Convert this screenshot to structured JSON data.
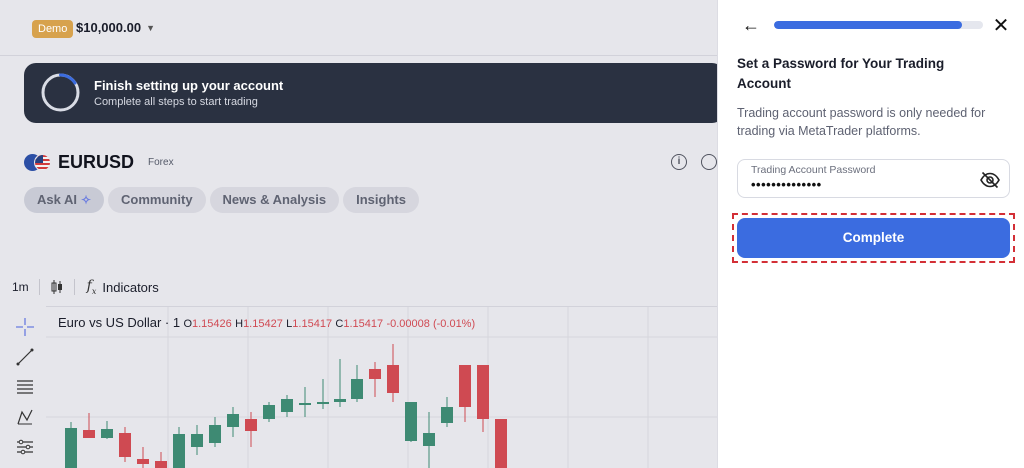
{
  "header": {
    "demo_badge": "Demo",
    "balance": "$10,000.00"
  },
  "setup_banner": {
    "title": "Finish setting up your account",
    "subtitle": "Complete all steps to start trading"
  },
  "instrument": {
    "symbol": "EURUSD",
    "type": "Forex"
  },
  "tabs": [
    {
      "label": "Ask AI"
    },
    {
      "label": "Community"
    },
    {
      "label": "News & Analysis"
    },
    {
      "label": "Insights"
    }
  ],
  "chart_toolbar": {
    "timeframe": "1m",
    "indicators_label": "Indicators"
  },
  "chart_legend": {
    "name": "Euro vs US Dollar · 1",
    "o_key": "O",
    "o_val": "1.15426",
    "h_key": "H",
    "h_val": "1.15427",
    "l_key": "L",
    "l_val": "1.15417",
    "c_key": "C",
    "c_val": "1.15417",
    "change": "-0.00008 (-0.01%)"
  },
  "colors": {
    "up": "#3e8a73",
    "down": "#cf4a52",
    "accent": "#3b6ce0",
    "highlight": "#d32f36"
  },
  "chart_data": {
    "type": "candlestick",
    "candles": [
      {
        "dir": "up"
      },
      {
        "dir": "down"
      },
      {
        "dir": "up"
      },
      {
        "dir": "down"
      },
      {
        "dir": "down"
      },
      {
        "dir": "down"
      },
      {
        "dir": "up"
      },
      {
        "dir": "up"
      },
      {
        "dir": "up"
      },
      {
        "dir": "up"
      },
      {
        "dir": "down"
      },
      {
        "dir": "up"
      },
      {
        "dir": "up"
      },
      {
        "dir": "up"
      },
      {
        "dir": "up"
      },
      {
        "dir": "up"
      },
      {
        "dir": "up"
      },
      {
        "dir": "down"
      },
      {
        "dir": "down"
      },
      {
        "dir": "up"
      },
      {
        "dir": "up"
      },
      {
        "dir": "up"
      },
      {
        "dir": "down"
      },
      {
        "dir": "down"
      }
    ]
  },
  "panel": {
    "progress": 0.9,
    "title": "Set a Password for Your Trading Account",
    "description": "Trading account password is only needed for trading via MetaTrader platforms.",
    "password_label": "Trading Account Password",
    "password_value": "••••••••••••••",
    "complete_label": "Complete",
    "icons": [
      "arrow-left-icon",
      "close-icon",
      "eye-off-icon"
    ]
  }
}
